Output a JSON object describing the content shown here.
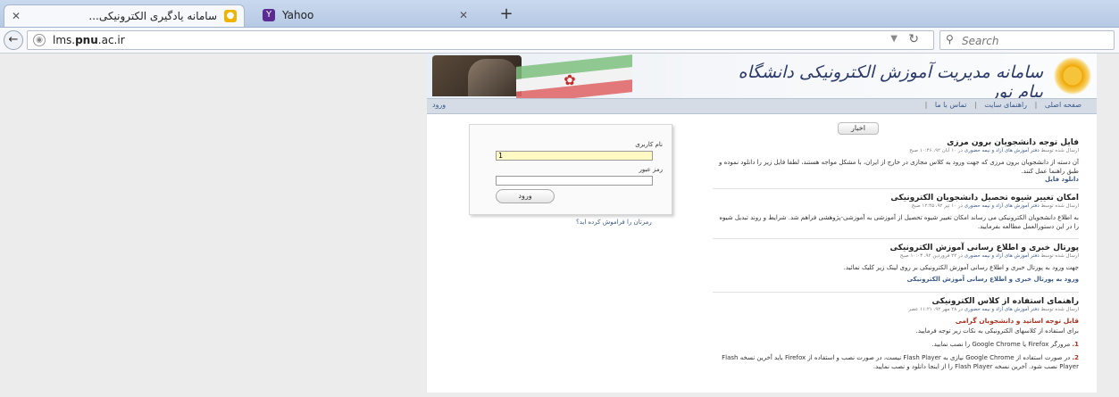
{
  "browser": {
    "tabs": [
      {
        "title": "سامانه یادگیری الکترونیکی...",
        "active": true
      },
      {
        "title": "Yahoo",
        "active": false
      }
    ],
    "url": {
      "host_prefix": "lms.",
      "host_bold": "pnu",
      "host_suffix": ".ac.ir"
    },
    "search_placeholder": "Search"
  },
  "site": {
    "title": "سامانه مدیریت آموزش الکترونیکی دانشگاه پیام نور",
    "nav": {
      "items": [
        "صفحه اصلی",
        "راهنمای سایت",
        "تماس با ما"
      ],
      "login_link": "ورود"
    }
  },
  "login": {
    "username_label": "نام کاربری",
    "username_value": "1",
    "password_label": "رمز عبور",
    "submit": "ورود",
    "forgot": "رمزتان را فراموش کرده اید؟"
  },
  "news": {
    "header": "اخبار",
    "items": [
      {
        "title": "فایل توجه دانشجویان برون مرزی",
        "meta_prefix": "ارسال شده توسط",
        "author": "دفتر آموزش های آزاد و نیمه حضوری",
        "meta_suffix": "در ۱۰ آبان ۹۲، ۱۰:۴۶ صبح",
        "body": "آن دسته از دانشجویان برون مرزی که جهت ورود به کلاس مجازی در خارج از ایران، با مشکل مواجه هستند، لطفا فایل زیر را دانلود نموده و طبق راهنما عمل کنند.",
        "link": "دانلود فایل"
      },
      {
        "title": "امکان تغییر شیوه تحصیل دانشجویان الکترونیکی",
        "meta_prefix": "ارسال شده توسط",
        "author": "دفتر آموزش های آزاد و نیمه حضوری",
        "meta_suffix": "در ۱۰ تیر ۹۲، ۱۲:۴۵ صبح",
        "body": "به اطلاع دانشجویان الکترونیکی می رساند امکان تغییر شیوه تحصیل از آموزشی به آموزشی-پژوهشی فراهم شد. شرایط و روند تبدیل شیوه را در این دستورالعمل مطالعه بفرمایید.",
        "link": ""
      },
      {
        "title": "پورتال خبری و اطلاع رسانی آموزش الکترونیکی",
        "meta_prefix": "ارسال شده توسط",
        "author": "دفتر آموزش های آزاد و نیمه حضوری",
        "meta_suffix": "در ۲۲ فروردین ۹۲، ۱۰:۰۳ صبح",
        "body": "جهت ورود به پورتال خبری و اطلاع رسانی آموزش الکترونیکی بر روی لینک زیر کلیک نمائید.",
        "link": "ورود به پورتال خبری و اطلاع رسانی آموزش الکترونیکی"
      },
      {
        "title": "راهنمای استفاده از کلاس الکترونیکی",
        "meta_prefix": "ارسال شده توسط",
        "author": "دفتر آموزش های آزاد و نیمه حضوری",
        "meta_suffix": "در ۲۸ مهر ۹۲، ۱۱:۲۱ عصر",
        "subhead": "قابل توجه اساتید و دانشجویان گرامی",
        "body": "برای استفاده از کلاسهای الکترونیکی به نکات زیر توجه فرمایید.",
        "steps": [
          {
            "num": "1.",
            "text": "مرورگر Firefox یا Google Chrome را نصب نمایید."
          },
          {
            "num": "2.",
            "text": "در صورت استفاده از Google Chrome نیازی به Flash Player نیست، در صورت نصب و استفاده از Firefox باید آخرین نسخه Flash Player نصب شود. آخرین نسخه Flash Player را از اینجا دانلود و نصب نمایید."
          }
        ]
      }
    ]
  },
  "colors": {
    "accent_link": "#3b5a8a",
    "highlight_red": "#b03020",
    "input_highlight": "#fff9c4"
  }
}
